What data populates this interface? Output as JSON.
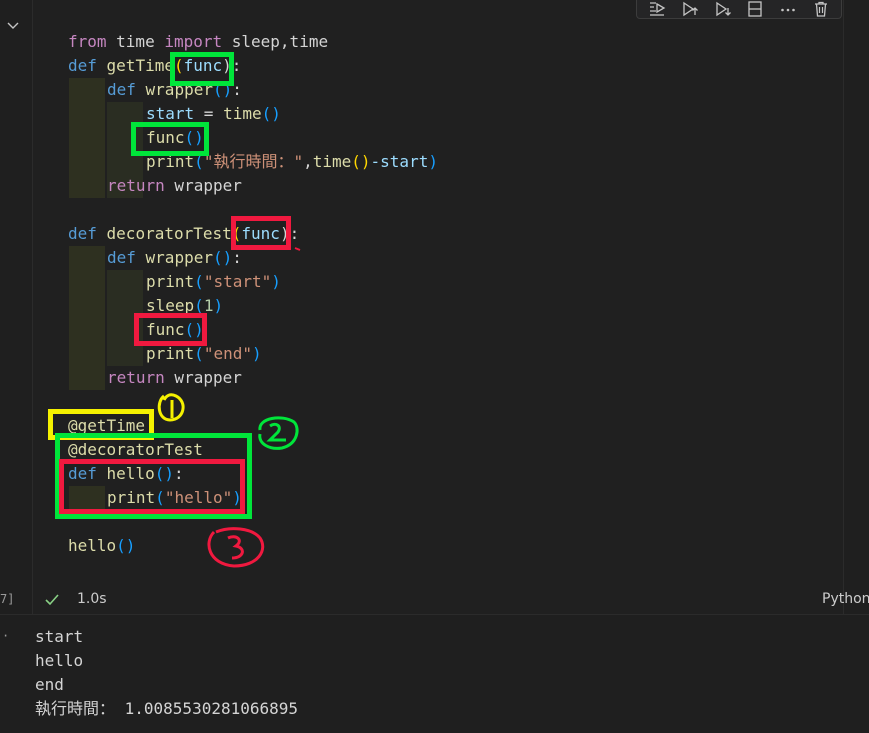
{
  "cell": {
    "execution_count": "7]",
    "status_icon": "check-icon",
    "exec_time": "1.0s",
    "language": "Python"
  },
  "toolbar": {
    "icons": [
      "run-by-line-icon",
      "execute-above-icon",
      "execute-below-icon",
      "split-cell-icon",
      "more-actions-icon",
      "delete-icon"
    ]
  },
  "code": {
    "l1": {
      "a": "from",
      "b": " time ",
      "c": "import",
      "d": " sleep,time"
    },
    "l2": {
      "a": "def",
      "b": " getTime",
      "c": "(",
      "d": "func",
      "e": "):"
    },
    "l3": {
      "a": "def",
      "b": " wrapper",
      "c": "()",
      "d": ":"
    },
    "l4": {
      "a": "start",
      "b": " = ",
      "c": "time",
      "d": "()"
    },
    "l5": {
      "a": "func",
      "b": "()"
    },
    "l6": {
      "a": "print",
      "b": "(",
      "c": "\"執行時間：\"",
      "d": ",",
      "e": "time",
      "f": "()",
      "g": "-start",
      "h": ")"
    },
    "l7": {
      "a": "return",
      "b": " wrapper"
    },
    "l9": {
      "a": "def",
      "b": " decoratorTest",
      "c": "(",
      "d": "func",
      "e": "):"
    },
    "l10": {
      "a": "def",
      "b": " wrapper",
      "c": "()",
      "d": ":"
    },
    "l11": {
      "a": "print",
      "b": "(",
      "c": "\"start\"",
      "d": ")"
    },
    "l12": {
      "a": "sleep",
      "b": "(",
      "c": "1",
      "d": ")"
    },
    "l13": {
      "a": "func",
      "b": "()"
    },
    "l14": {
      "a": "print",
      "b": "(",
      "c": "\"end\"",
      "d": ")"
    },
    "l15": {
      "a": "return",
      "b": " wrapper"
    },
    "l17": {
      "a": "@getTime"
    },
    "l18": {
      "a": "@decoratorTest"
    },
    "l19": {
      "a": "def",
      "b": " hello",
      "c": "()",
      "d": ":"
    },
    "l20": {
      "a": "print",
      "b": "(",
      "c": "\"hello\"",
      "d": ")"
    },
    "l22": {
      "a": "hello",
      "b": "()"
    }
  },
  "output": {
    "lines": [
      "start",
      "hello",
      "end",
      "執行時間： 1.0085530281066895"
    ]
  },
  "colors": {
    "green_box": "#00e53a",
    "red_box": "#f0193f",
    "yellow_box": "#f5f100"
  }
}
